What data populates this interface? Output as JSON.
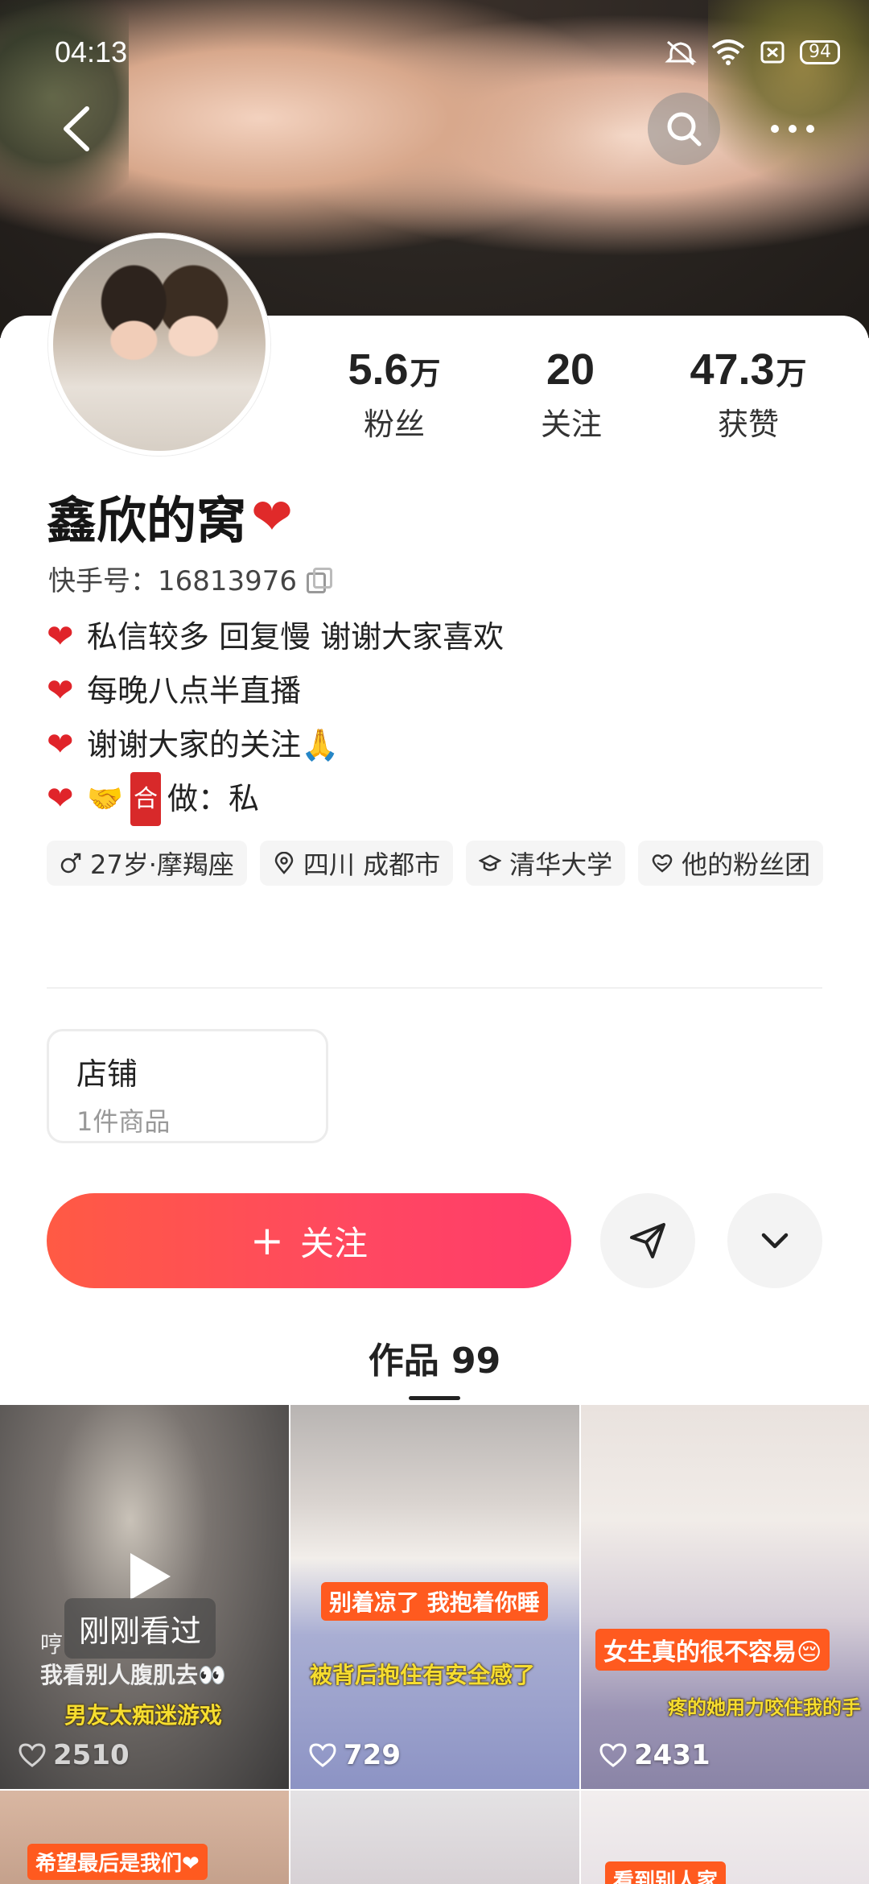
{
  "status_bar": {
    "time": "04:13",
    "battery": "94",
    "icons": [
      "mute-icon",
      "wifi-icon",
      "sim-icon",
      "battery-icon"
    ]
  },
  "nav": {
    "back_icon": "chevron-left-icon",
    "search_icon": "search-icon",
    "more_icon": "more-dots-icon"
  },
  "profile": {
    "name": "鑫欣的窝",
    "name_emoji": "❤",
    "id_label": "快手号：16813976",
    "stats": [
      {
        "value": "5.6",
        "unit": "万",
        "label": "粉丝"
      },
      {
        "value": "20",
        "unit": "",
        "label": "关注"
      },
      {
        "value": "47.3",
        "unit": "万",
        "label": "获赞"
      }
    ],
    "bio": [
      {
        "prefix": "❤",
        "text": "私信较多 回复慢 谢谢大家喜欢"
      },
      {
        "prefix": "❤",
        "text": "每晚八点半直播"
      },
      {
        "prefix": "❤",
        "text": "谢谢大家的关注🙏"
      },
      {
        "prefix": "❤",
        "hand": "🤝",
        "box": "合",
        "text": "做：私"
      }
    ],
    "tags": [
      {
        "icon": "male-icon",
        "text": "27岁·摩羯座"
      },
      {
        "icon": "location-icon",
        "text": "四川 成都市"
      },
      {
        "icon": "graduation-cap-icon",
        "text": "清华大学"
      },
      {
        "icon": "fan-club-heart-icon",
        "text": "他的粉丝团"
      }
    ]
  },
  "shop": {
    "title": "店铺",
    "subtitle": "1件商品"
  },
  "actions": {
    "follow_plus": "+",
    "follow_label": "关注",
    "share_icon": "send-icon",
    "expand_icon": "chevron-down-icon"
  },
  "tabs": {
    "works_label": "作品 99"
  },
  "videos": [
    {
      "likes": "2510",
      "badge": "刚刚看过",
      "caption_top": "哼",
      "caption_mid": "我看别人腹肌去👀",
      "caption_bottom": "男友太痴迷游戏"
    },
    {
      "likes": "729",
      "caption_top": "别着凉了 我抱着你睡",
      "caption_bottom": "被背后抱住有安全感了"
    },
    {
      "likes": "2431",
      "caption_top": "女生真的很不容易😔",
      "caption_bottom": "疼的她用力咬住我的手"
    },
    {
      "caption_top": "希望最后是我们❤"
    },
    {},
    {
      "caption_top": "看到别人家"
    }
  ],
  "colors": {
    "follow_start": "#ff5a44",
    "follow_end": "#ff3a6b",
    "heart": "#e02a2a",
    "caption_orange": "#ff5a1f"
  }
}
